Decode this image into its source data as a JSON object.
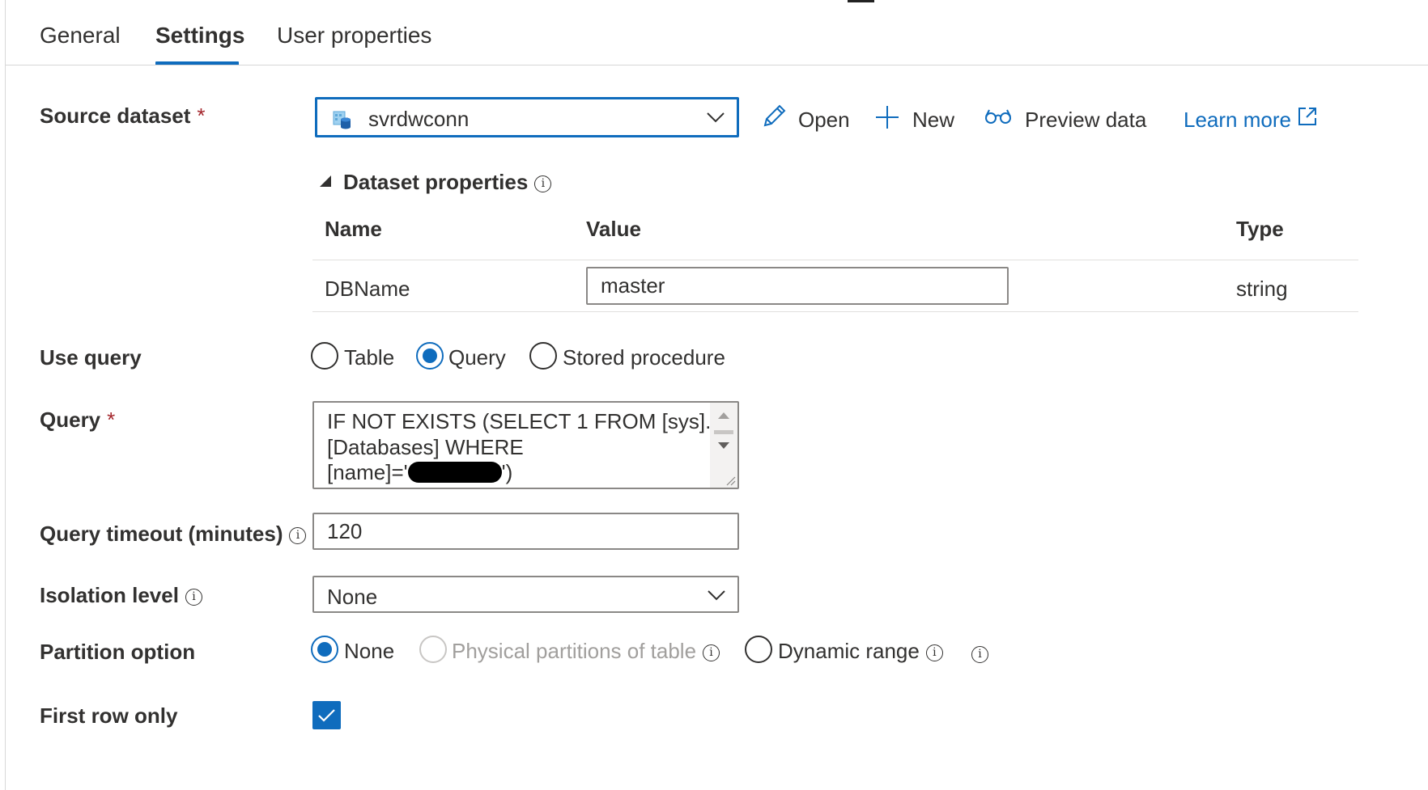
{
  "tabs": [
    {
      "label": "General",
      "active": false
    },
    {
      "label": "Settings",
      "active": true
    },
    {
      "label": "User properties",
      "active": false
    }
  ],
  "source_dataset": {
    "label": "Source dataset",
    "required_marker": "*",
    "selected": "svrdwconn",
    "icon": "sql-database-icon",
    "actions": {
      "open": "Open",
      "new": "New",
      "preview": "Preview data",
      "learn_more": "Learn more"
    }
  },
  "dataset_properties": {
    "title": "Dataset properties",
    "columns": [
      "Name",
      "Value",
      "Type"
    ],
    "rows": [
      {
        "name": "DBName",
        "value": "master",
        "type": "string"
      }
    ]
  },
  "use_query": {
    "label": "Use query",
    "options": [
      {
        "label": "Table",
        "checked": false,
        "disabled": false
      },
      {
        "label": "Query",
        "checked": true,
        "disabled": false
      },
      {
        "label": "Stored procedure",
        "checked": false,
        "disabled": false
      }
    ]
  },
  "query": {
    "label": "Query",
    "required_marker": "*",
    "lines": [
      "IF NOT EXISTS (SELECT 1 FROM [sys].",
      "[Databases] WHERE",
      "[name]='",
      "')"
    ]
  },
  "query_timeout": {
    "label": "Query timeout (minutes)",
    "value": "120"
  },
  "isolation_level": {
    "label": "Isolation level",
    "selected": "None"
  },
  "partition_option": {
    "label": "Partition option",
    "options": [
      {
        "label": "None",
        "checked": true,
        "disabled": false
      },
      {
        "label": "Physical partitions of table",
        "checked": false,
        "disabled": true
      },
      {
        "label": "Dynamic range",
        "checked": false,
        "disabled": false
      }
    ]
  },
  "first_row_only": {
    "label": "First row only",
    "checked": true
  },
  "colors": {
    "accent": "#0f6cbd",
    "required": "#a4262c",
    "text": "#323130",
    "border": "#8a8886",
    "disabled": "#a19f9d"
  }
}
